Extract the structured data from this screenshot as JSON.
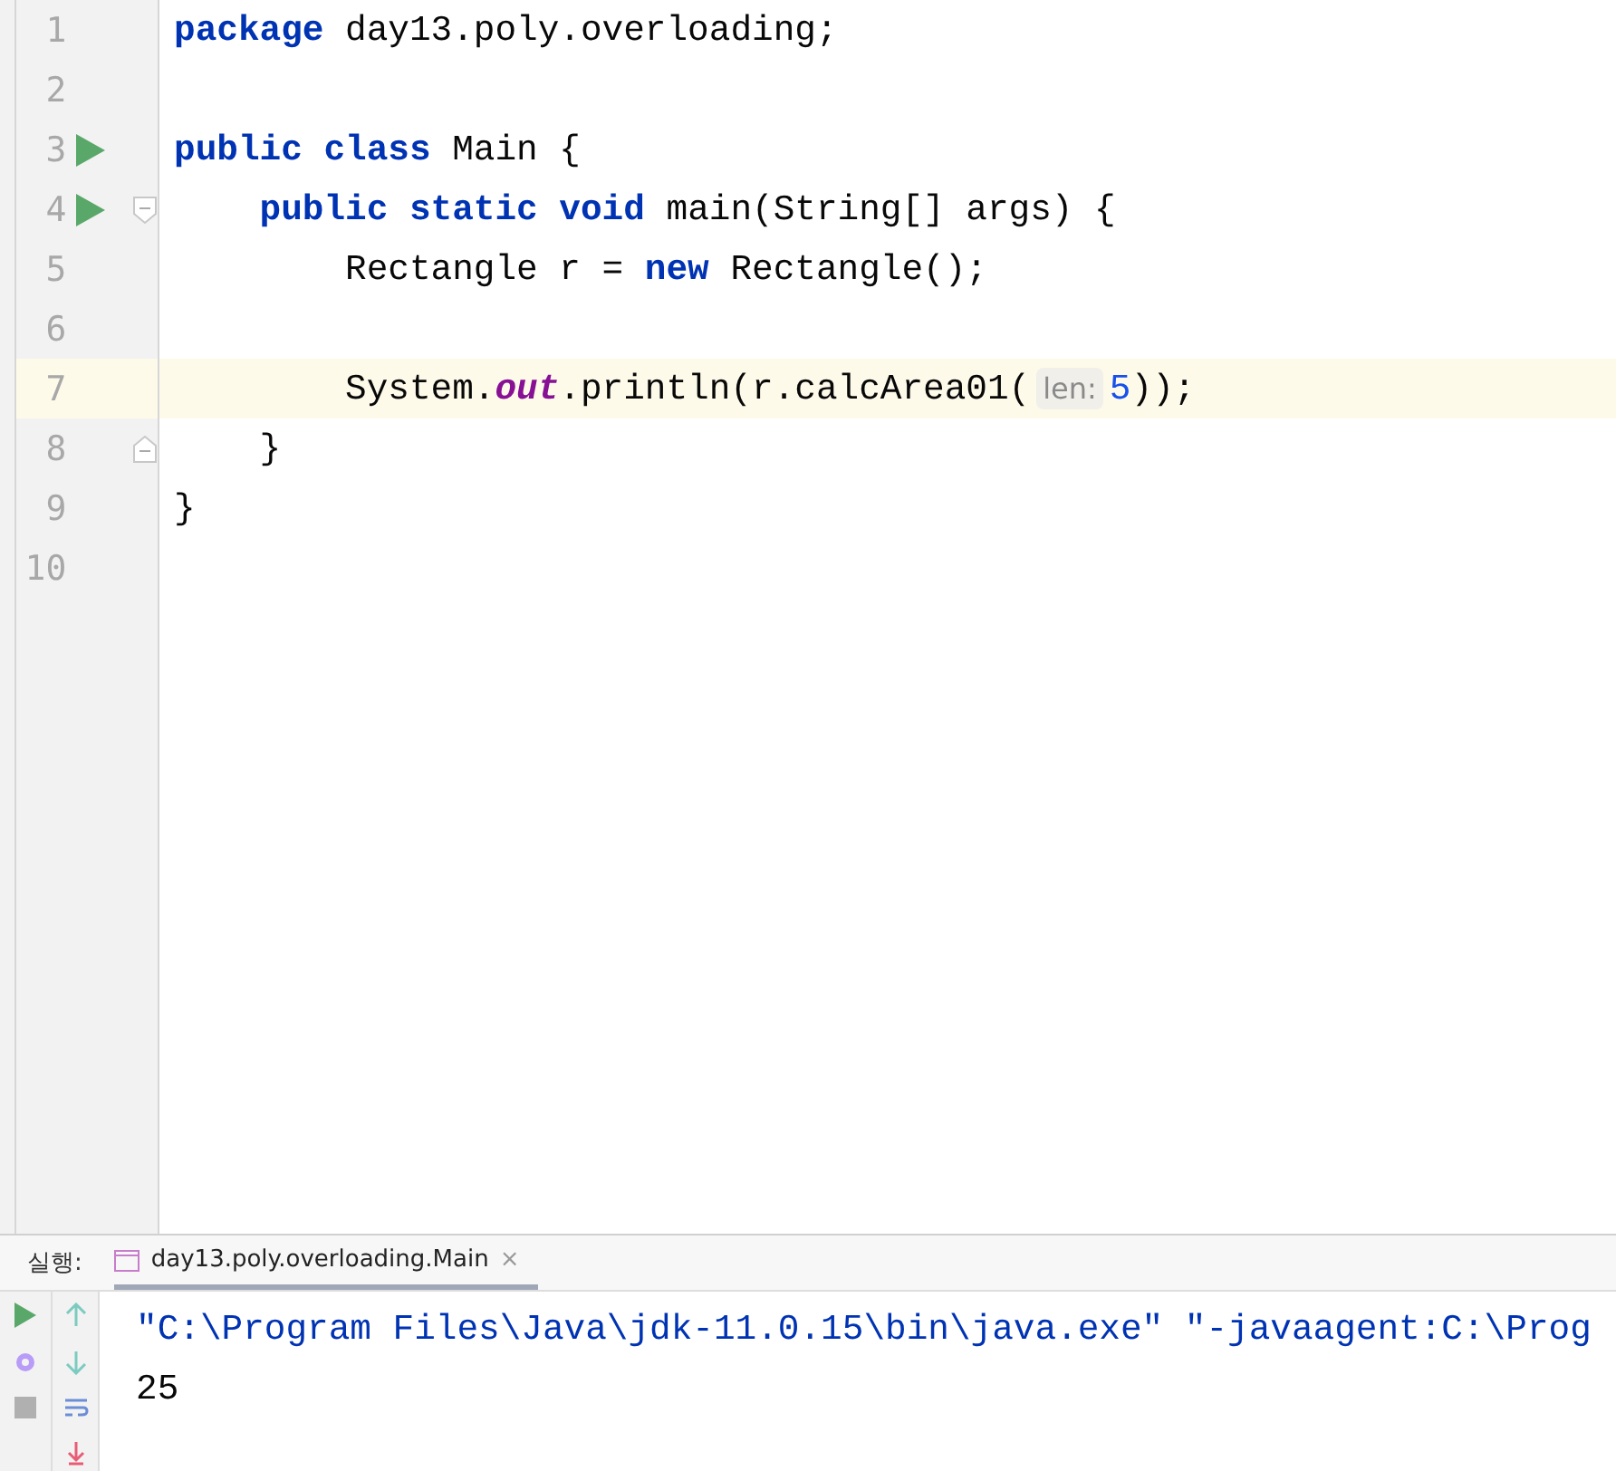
{
  "editor": {
    "lines": [
      {
        "number": "1",
        "run": false,
        "fold_start": false,
        "fold_end": false,
        "current": false,
        "tokens": [
          {
            "kind": "kw",
            "text": "package"
          },
          {
            "kind": "plain",
            "text": " day13.poly.overloading;"
          }
        ]
      },
      {
        "number": "2",
        "run": false,
        "fold_start": false,
        "fold_end": false,
        "current": false
      },
      {
        "number": "3",
        "run": true,
        "fold_start": false,
        "fold_end": false,
        "current": false,
        "tokens": [
          {
            "kind": "kw",
            "text": "public class"
          },
          {
            "kind": "plain",
            "text": " Main {"
          }
        ]
      },
      {
        "number": "4",
        "run": true,
        "fold_start": true,
        "fold_end": false,
        "current": false,
        "tokens": [
          {
            "kind": "kw",
            "text": "    public static void"
          },
          {
            "kind": "plain",
            "text": " main(String[] args) {"
          }
        ]
      },
      {
        "number": "5",
        "run": false,
        "fold_start": false,
        "fold_end": false,
        "current": false,
        "tokens": [
          {
            "kind": "plain",
            "text": "        Rectangle r = "
          },
          {
            "kind": "kw",
            "text": "new"
          },
          {
            "kind": "plain",
            "text": " Rectangle();"
          }
        ]
      },
      {
        "number": "6",
        "run": false,
        "fold_start": false,
        "fold_end": false,
        "current": false
      },
      {
        "number": "7",
        "run": false,
        "fold_start": false,
        "fold_end": false,
        "current": true,
        "tokens": [
          {
            "kind": "plain",
            "text": "        System."
          },
          {
            "kind": "field",
            "text": "out"
          },
          {
            "kind": "plain",
            "text": ".println(r.calcArea01("
          },
          {
            "kind": "hint",
            "text": "len:"
          },
          {
            "kind": "num",
            "text": "5"
          },
          {
            "kind": "plain",
            "text": "));"
          }
        ]
      },
      {
        "number": "8",
        "run": false,
        "fold_start": false,
        "fold_end": true,
        "current": false,
        "tokens": [
          {
            "kind": "plain",
            "text": "    }"
          }
        ]
      },
      {
        "number": "9",
        "run": false,
        "fold_start": false,
        "fold_end": false,
        "current": false,
        "tokens": [
          {
            "kind": "plain",
            "text": "}"
          }
        ]
      },
      {
        "number": "10",
        "run": false,
        "fold_start": false,
        "fold_end": false,
        "current": false
      }
    ]
  },
  "run_panel": {
    "label": "실행:",
    "tab": {
      "title": "day13.poly.overloading.Main",
      "close": "×",
      "selected": true
    },
    "console": [
      {
        "kind": "command",
        "text": "\"C:\\Program Files\\Java\\jdk-11.0.15\\bin\\java.exe\" \"-javaagent:C:\\Prog"
      },
      {
        "kind": "output",
        "text": "25"
      }
    ]
  }
}
